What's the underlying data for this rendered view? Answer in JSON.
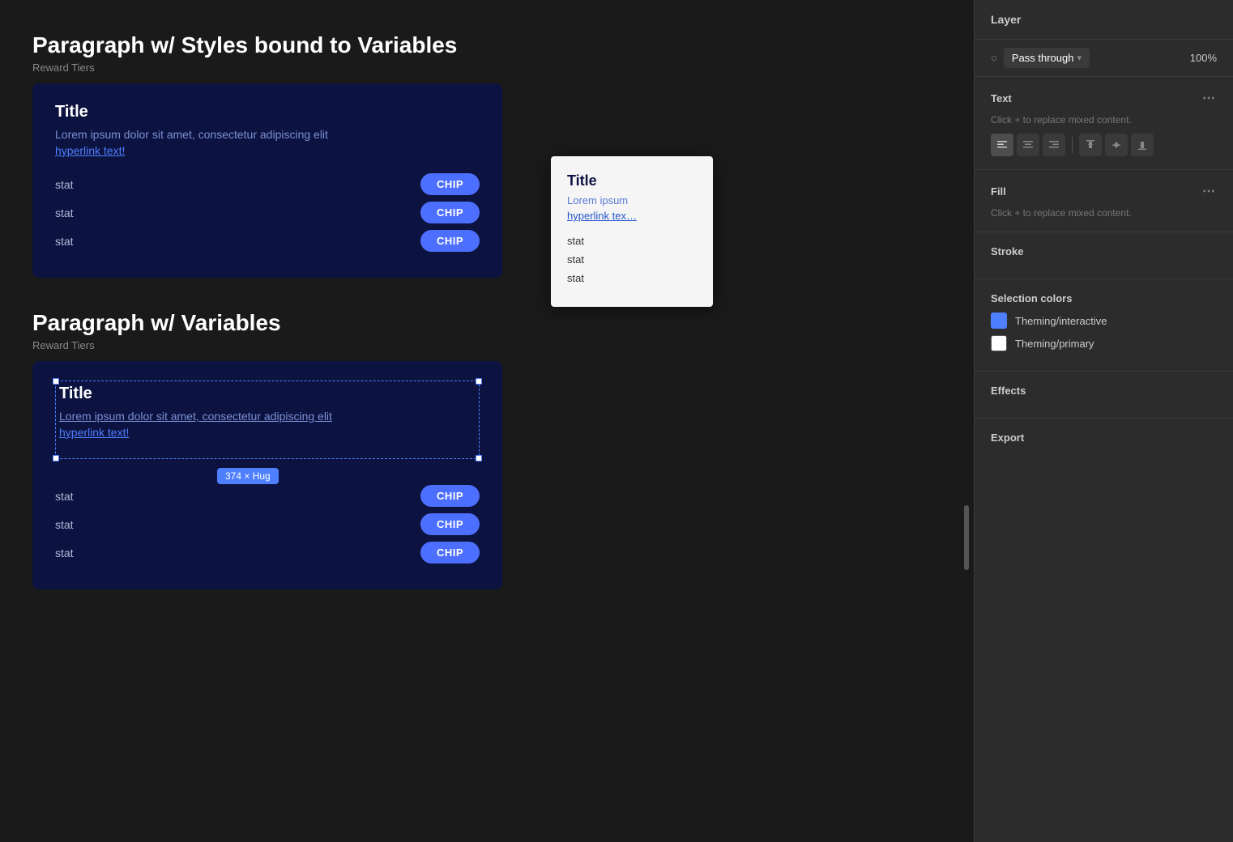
{
  "page": {
    "section1_title": "Paragraph w/ Styles bound to Variables",
    "section1_subtitle": "Reward Tiers",
    "section2_title": "Paragraph w/ Variables",
    "section2_subtitle": "Reward Tiers",
    "card1": {
      "title": "Title",
      "body": "Lorem ipsum dolor sit amet, consectetur adipiscing elit",
      "hyperlink": "hyperlink text!",
      "stats": [
        {
          "label": "stat",
          "chip": "CHIP"
        },
        {
          "label": "stat",
          "chip": "CHIP"
        },
        {
          "label": "stat",
          "chip": "CHIP"
        }
      ]
    },
    "card2": {
      "title": "Title",
      "body": "Lorem ipsum dolor sit amet, consectetur adipiscing elit",
      "hyperlink": "hyperlink text!",
      "size_badge": "374 × Hug",
      "stats": [
        {
          "label": "stat",
          "chip": "CHIP"
        },
        {
          "label": "stat",
          "chip": "CHIP"
        },
        {
          "label": "stat",
          "chip": "CHIP"
        }
      ]
    },
    "preview": {
      "title": "Title",
      "body": "Lorem ipsum",
      "hyperlink": "hyperlink tex…",
      "stats": [
        "stat",
        "stat",
        "stat"
      ]
    }
  },
  "panel": {
    "layer_heading": "Layer",
    "blend_mode": "Pass through",
    "blend_mode_arrow": "▾",
    "opacity": "100%",
    "blend_icon": "○",
    "text_heading": "Text",
    "text_placeholder": "Click + to replace mixed content.",
    "fill_heading": "Fill",
    "fill_placeholder": "Click + to replace mixed content.",
    "stroke_heading": "Stroke",
    "selection_colors_heading": "Selection colors",
    "color1_label": "Theming/interactive",
    "color2_label": "Theming/primary",
    "effects_heading": "Effects",
    "export_heading": "Export",
    "dots": "⋯",
    "align_icons": [
      "≡",
      "≡",
      "≡",
      "↑",
      "↕",
      "↓"
    ]
  }
}
